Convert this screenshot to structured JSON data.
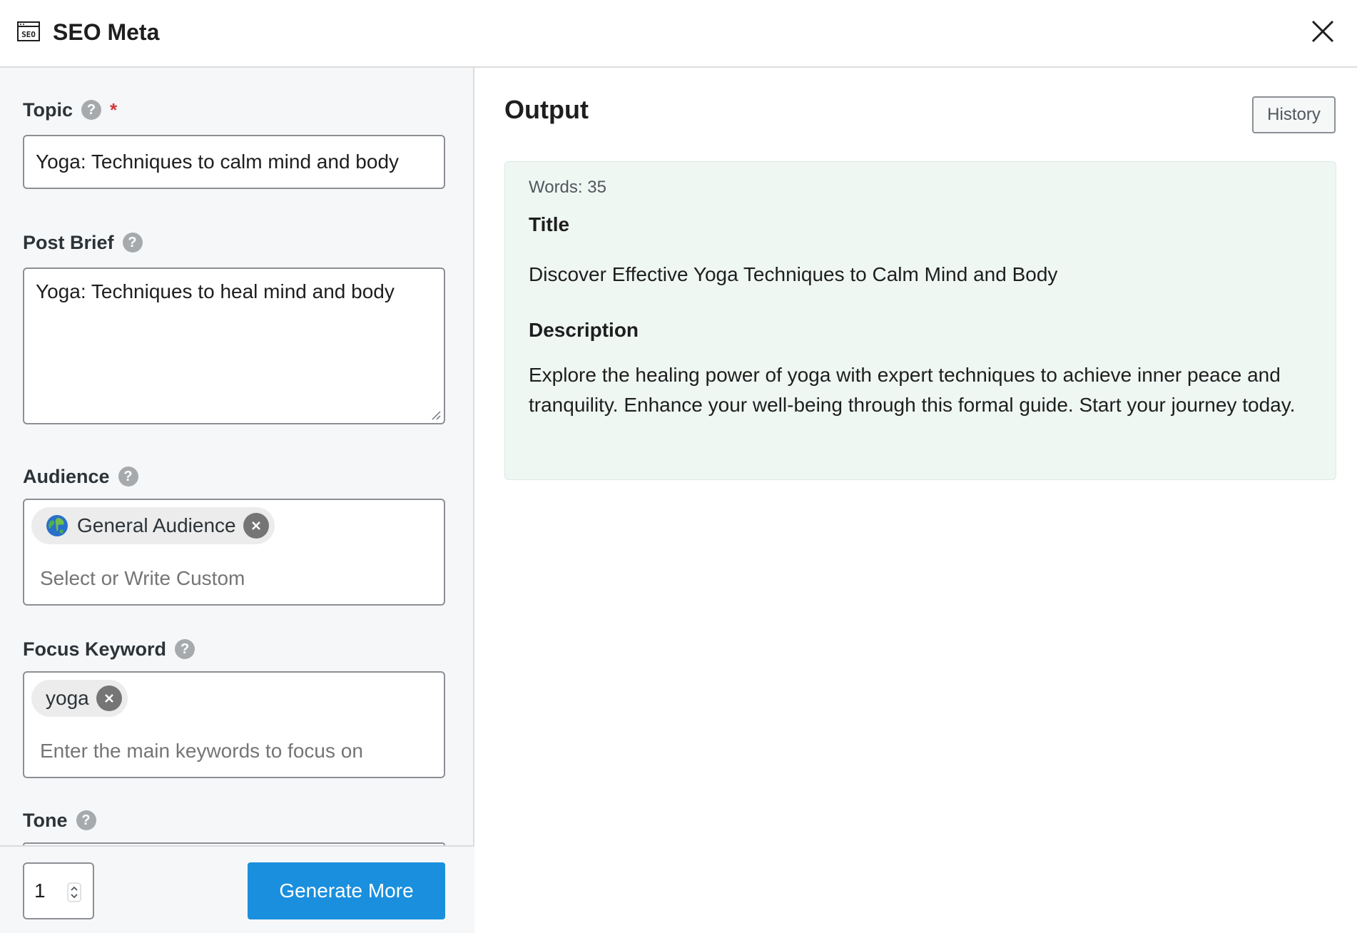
{
  "header": {
    "title": "SEO Meta",
    "icon": "seo-icon",
    "close_icon": "close-icon"
  },
  "form": {
    "topic": {
      "label": "Topic",
      "required_mark": "*",
      "value": "Yoga: Techniques to calm mind and body"
    },
    "post_brief": {
      "label": "Post Brief",
      "value": "Yoga: Techniques to heal mind and body"
    },
    "audience": {
      "label": "Audience",
      "chip": "General Audience",
      "placeholder": "Select or Write Custom"
    },
    "focus_keyword": {
      "label": "Focus Keyword",
      "chip": "yoga",
      "placeholder": "Enter the main keywords to focus on"
    },
    "tone": {
      "label": "Tone"
    },
    "help_glyph": "?"
  },
  "footer": {
    "quantity": "1",
    "generate_label": "Generate More"
  },
  "output": {
    "title": "Output",
    "history_label": "History",
    "words": "Words: 35",
    "title_heading": "Title",
    "title_text": "Discover Effective Yoga Techniques to Calm Mind and Body",
    "description_heading": "Description",
    "description_text": "Explore the healing power of yoga with expert techniques to achieve inner peace and tranquility. Enhance your well-being through this formal guide. Start your journey today."
  },
  "colors": {
    "primary_button": "#1a8fde",
    "output_background": "#eff7f3",
    "required": "#d63638"
  }
}
